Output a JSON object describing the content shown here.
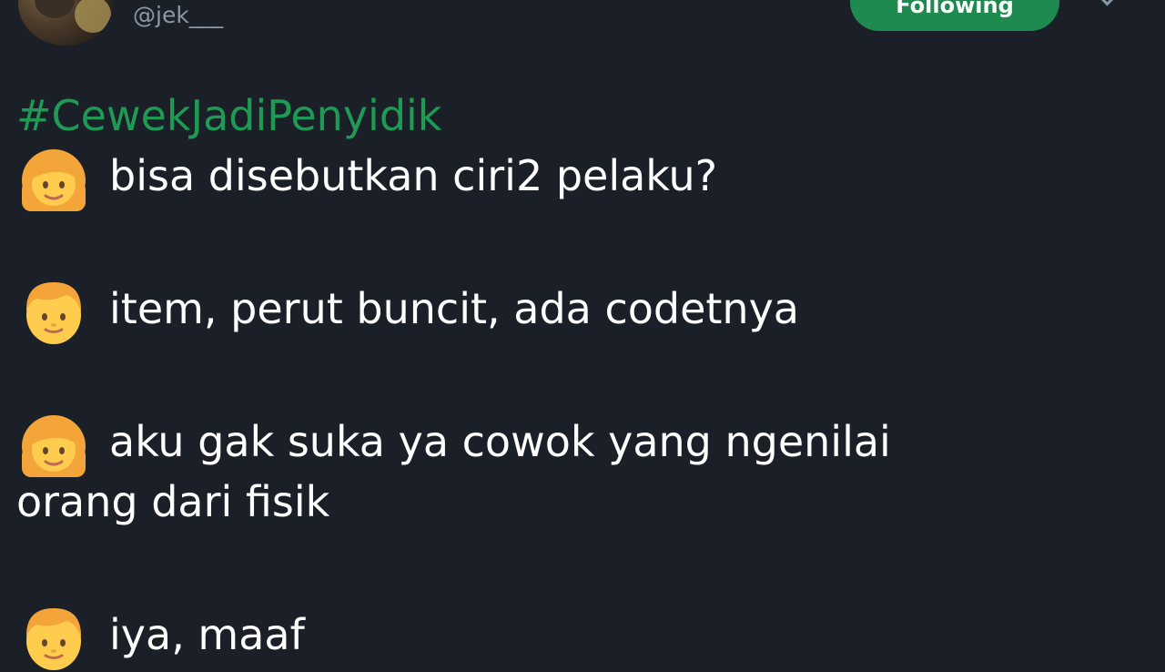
{
  "header": {
    "handle": "@jek___",
    "follow_label": "Following"
  },
  "tweet": {
    "hashtag": "#CewekJadiPenyidik",
    "lines": [
      {
        "speaker": "woman-emoji",
        "text": "bisa disebutkan ciri2 pelaku?"
      },
      {
        "speaker": "man-emoji",
        "text": "item, perut buncit, ada codetnya"
      },
      {
        "speaker": "woman-emoji",
        "text": "aku gak suka ya cowok yang ngenilai",
        "continuation": "orang dari fisik"
      },
      {
        "speaker": "man-emoji",
        "text": "iya, maaf"
      }
    ]
  },
  "colors": {
    "background": "#1b1f27",
    "hashtag": "#1f9a55",
    "follow_button": "#1f8a4f",
    "muted": "#8b98a5"
  }
}
